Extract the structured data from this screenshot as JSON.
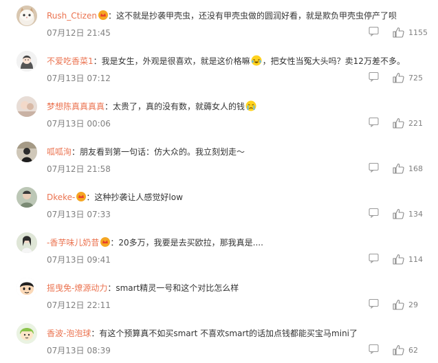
{
  "comments": [
    {
      "username": "Rush_Ctizen",
      "badge": "vip-crown-icon",
      "text": "这不就是抄袭甲壳虫，还没有甲壳虫做的圆润好看，就是欺负甲壳虫停产了呗",
      "time": "07月12日 21:45",
      "likes": "1155",
      "avatar": "cat-avatar"
    },
    {
      "username": "不爱吃香菜1",
      "text": "我是女生，外观是很喜欢，就是这价格嘛",
      "emoji": "laughing-crying-emoji",
      "text_after": "，把女性当冤大头吗？卖12万差不多。",
      "time": "07月13日 07:12",
      "likes": "725",
      "avatar": "girl-drawing-avatar"
    },
    {
      "username": "梦想陈真真真真",
      "text": "太贵了，真的没有数，就薅女人的钱",
      "emoji": "crying-emoji",
      "time": "07月13日 00:06",
      "likes": "221",
      "avatar": "photo-avatar"
    },
    {
      "username": "呱呱洵",
      "text": "朋友看到第一句话：仿大众的。我立刻划走～",
      "time": "07月12日 21:58",
      "likes": "168",
      "avatar": "dark-figure-avatar"
    },
    {
      "username": "Dkeke-",
      "badge": "vip-crown-icon",
      "text": "这种抄袭让人感觉好low",
      "time": "07月13日 07:33",
      "likes": "134",
      "avatar": "person-avatar"
    },
    {
      "username": "-香芋味儿奶昔",
      "badge": "vip-crown-icon",
      "text": "20多万，我要是去买欧拉，那我真是....",
      "time": "07月13日 09:41",
      "likes": "114",
      "avatar": "girl-photo-avatar"
    },
    {
      "username": "摇曳免-燎源动力",
      "text": "smart精灵一号和这个对比怎么样",
      "time": "07月12日 22:11",
      "likes": "29",
      "avatar": "cartoon-boy-avatar"
    },
    {
      "username": "香波-泡泡球",
      "text": "有这个预算真不如买smart 不喜欢smart的话加点钱都能买宝马mini了",
      "time": "07月13日 08:39",
      "likes": "62",
      "avatar": "cartoon-girl-avatar"
    }
  ],
  "colors": {
    "username": "#eb7350",
    "time": "#808080",
    "text": "#333333"
  }
}
